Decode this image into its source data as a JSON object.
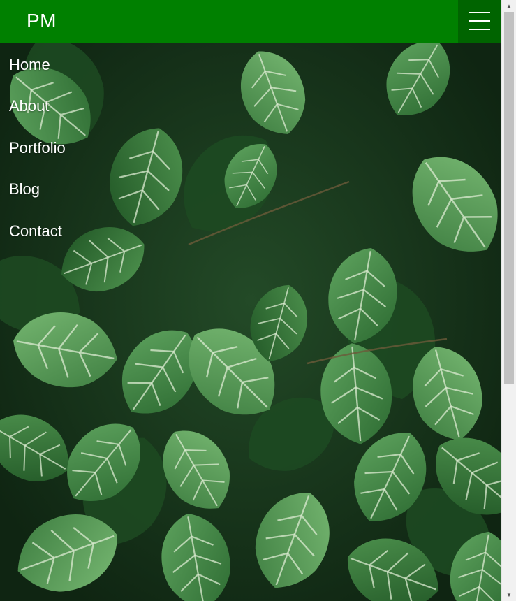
{
  "header": {
    "logo": "PM",
    "menu_icon": "hamburger-menu-icon"
  },
  "nav": {
    "items": [
      {
        "label": "Home"
      },
      {
        "label": "About"
      },
      {
        "label": "Portfolio"
      },
      {
        "label": "Blog"
      },
      {
        "label": "Contact"
      }
    ]
  },
  "background": {
    "description_icon": "leaves-photo",
    "colors": {
      "dark": "#143218",
      "mid": "#2f6b34",
      "light": "#5ea260",
      "vein": "#d8ead0"
    }
  },
  "colors": {
    "header": "#008000",
    "menu_button": "#006400",
    "text": "#ffffff"
  }
}
